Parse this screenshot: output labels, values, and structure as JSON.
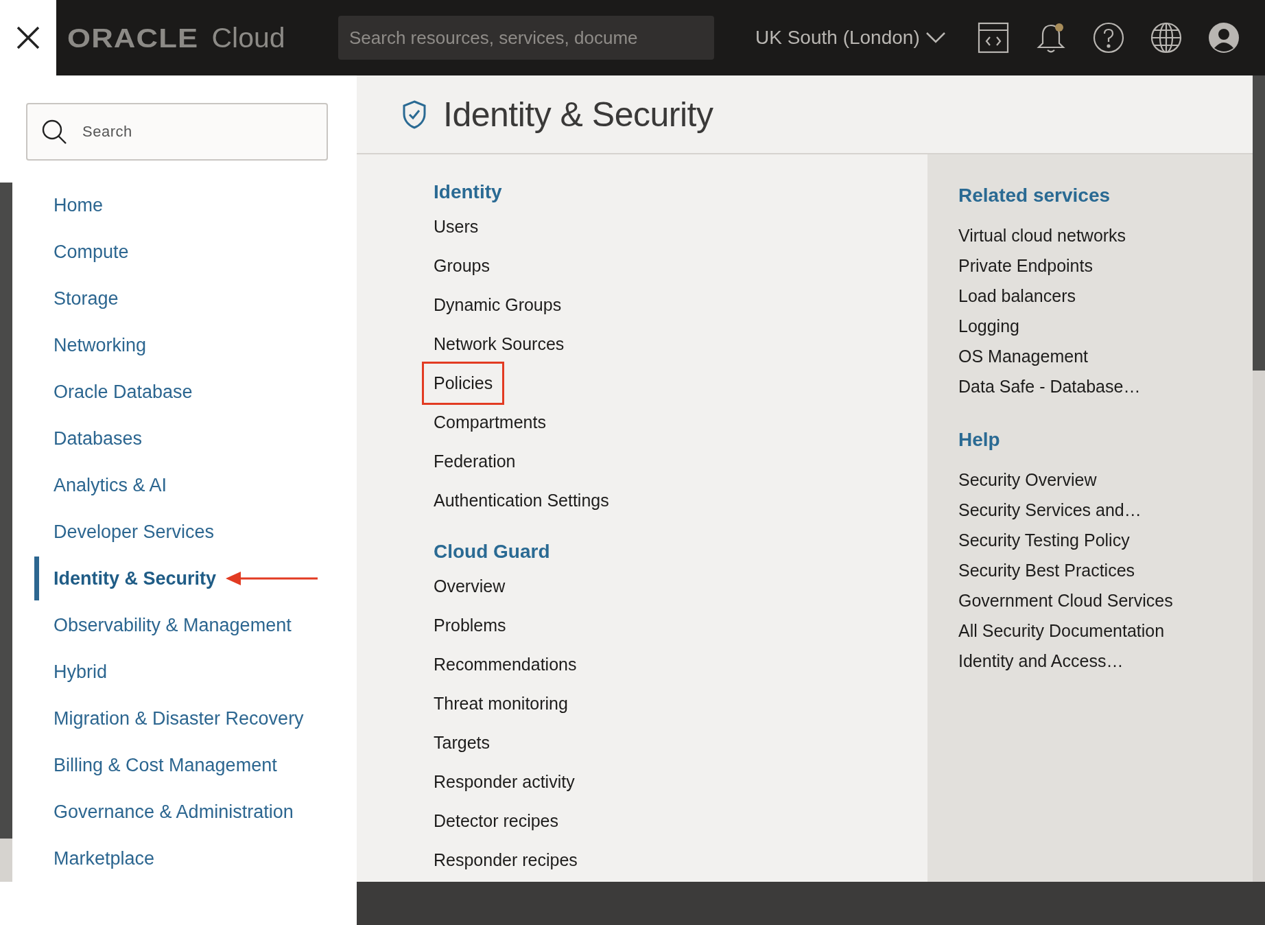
{
  "topbar": {
    "logo": "ORACLE",
    "product": "Cloud",
    "search": {
      "placeholder": "Search resources, services, docume"
    },
    "region": "UK South (London)",
    "notification_dot": true
  },
  "sidebar": {
    "search": {
      "placeholder": "Search"
    },
    "items": [
      {
        "label": "Home",
        "selected": false,
        "annotated": false
      },
      {
        "label": "Compute",
        "selected": false,
        "annotated": false
      },
      {
        "label": "Storage",
        "selected": false,
        "annotated": false
      },
      {
        "label": "Networking",
        "selected": false,
        "annotated": false
      },
      {
        "label": "Oracle Database",
        "selected": false,
        "annotated": false
      },
      {
        "label": "Databases",
        "selected": false,
        "annotated": false
      },
      {
        "label": "Analytics & AI",
        "selected": false,
        "annotated": false
      },
      {
        "label": "Developer Services",
        "selected": false,
        "annotated": false
      },
      {
        "label": "Identity & Security",
        "selected": true,
        "annotated": true
      },
      {
        "label": "Observability & Management",
        "selected": false,
        "annotated": false
      },
      {
        "label": "Hybrid",
        "selected": false,
        "annotated": false
      },
      {
        "label": "Migration & Disaster Recovery",
        "selected": false,
        "annotated": false
      },
      {
        "label": "Billing & Cost Management",
        "selected": false,
        "annotated": false
      },
      {
        "label": "Governance & Administration",
        "selected": false,
        "annotated": false
      },
      {
        "label": "Marketplace",
        "selected": false,
        "annotated": false
      }
    ]
  },
  "panel": {
    "title": "Identity & Security",
    "sections": [
      {
        "heading": "Identity",
        "items": [
          {
            "label": "Users",
            "highlighted": false
          },
          {
            "label": "Groups",
            "highlighted": false
          },
          {
            "label": "Dynamic Groups",
            "highlighted": false
          },
          {
            "label": "Network Sources",
            "highlighted": false
          },
          {
            "label": "Policies",
            "highlighted": true
          },
          {
            "label": "Compartments",
            "highlighted": false
          },
          {
            "label": "Federation",
            "highlighted": false
          },
          {
            "label": "Authentication Settings",
            "highlighted": false
          }
        ]
      },
      {
        "heading": "Cloud Guard",
        "items": [
          {
            "label": "Overview",
            "highlighted": false
          },
          {
            "label": "Problems",
            "highlighted": false
          },
          {
            "label": "Recommendations",
            "highlighted": false
          },
          {
            "label": "Threat monitoring",
            "highlighted": false
          },
          {
            "label": "Targets",
            "highlighted": false
          },
          {
            "label": "Responder activity",
            "highlighted": false
          },
          {
            "label": "Detector recipes",
            "highlighted": false
          },
          {
            "label": "Responder recipes",
            "highlighted": false
          }
        ]
      }
    ],
    "related": [
      {
        "heading": "Related services",
        "items": [
          "Virtual cloud networks",
          "Private Endpoints",
          "Load balancers",
          "Logging",
          "OS Management",
          "Data Safe - Database…"
        ]
      },
      {
        "heading": "Help",
        "items": [
          "Security Overview",
          "Security Services and…",
          "Security Testing Policy",
          "Security Best Practices",
          "Government Cloud Services",
          "All Security Documentation",
          "Identity and Access…"
        ]
      }
    ]
  }
}
